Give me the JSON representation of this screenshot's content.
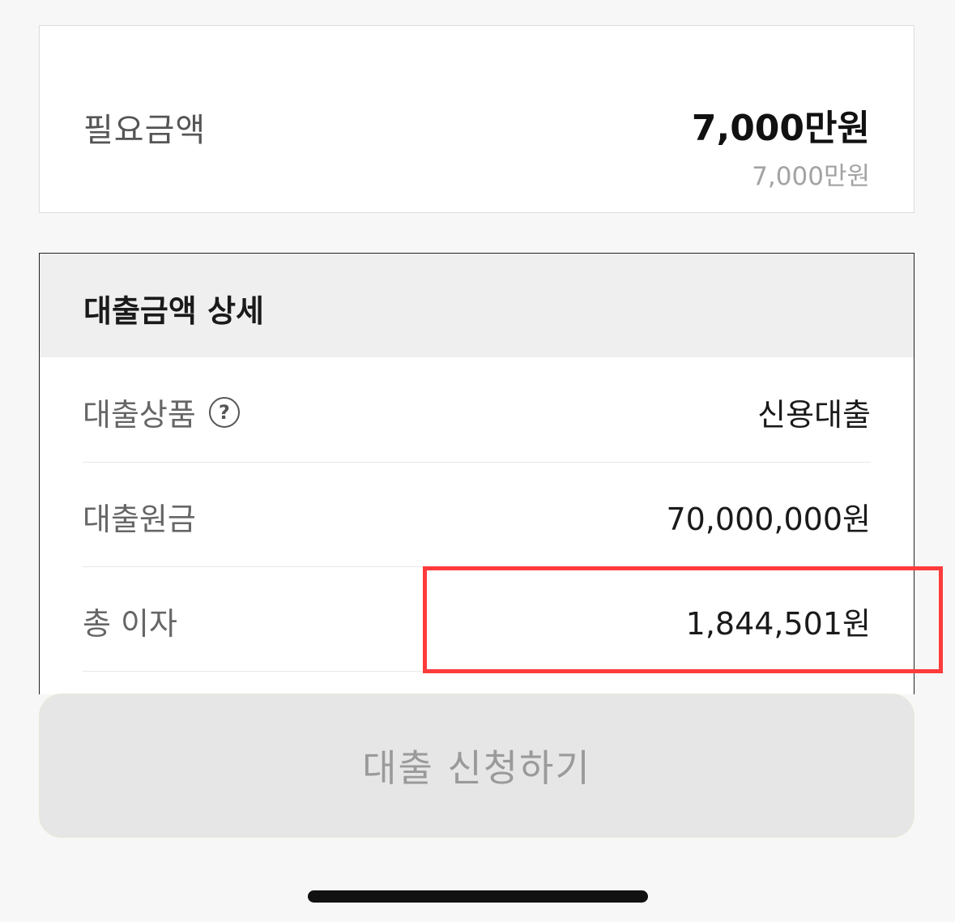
{
  "required_amount": {
    "label": "필요금액",
    "value": "7,000만원",
    "sub_value": "7,000만원"
  },
  "loan_detail": {
    "title": "대출금액 상세",
    "rows": [
      {
        "label": "대출상품",
        "value": "신용대출",
        "has_help": true
      },
      {
        "label": "대출원금",
        "value": "70,000,000원",
        "has_help": false
      },
      {
        "label": "총 이자",
        "value": "1,844,501원",
        "has_help": false
      }
    ]
  },
  "help_icon_glyph": "?",
  "apply_button": {
    "label": "대출 신청하기"
  },
  "colors": {
    "highlight": "#ff3b3b",
    "button_bg": "#e6e6e6",
    "button_text": "#9a9a9a"
  }
}
